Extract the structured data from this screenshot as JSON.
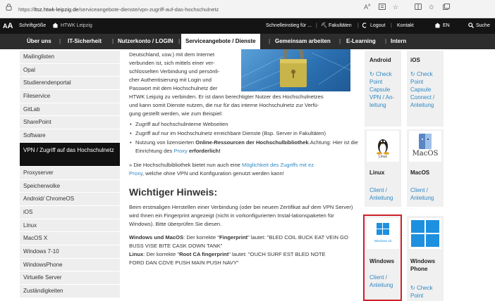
{
  "browser": {
    "url_prefix": "https://",
    "url_host": "ltsz.htwk-leipzig.de",
    "url_path": "/serviceangebote-dienste/vpn-zugriff-auf-das-hochschulnetz"
  },
  "topbar": {
    "font_size_label": "Schriftgröße",
    "home_label": "HTWK Leipzig",
    "quick_entry": "Schnelleinstieg für ...",
    "faculties": "Fakultäten",
    "logout": "Logout",
    "contact": "Kontakt",
    "language": "EN",
    "search": "Suche"
  },
  "mainnav": {
    "items": [
      "Über uns",
      "IT-Sicherheit",
      "Nutzerkonto / LOGIN",
      "Serviceangebote / Dienste",
      "Gemeinsam arbeiten",
      "E-Learning",
      "Intern"
    ]
  },
  "sidebar": {
    "items": [
      "Mailinglisten",
      "Opal",
      "Studierendenportal",
      "Fileservice",
      "GitLab",
      "SharePoint",
      "Software",
      "VPN / Zugriff auf das Hochschulnetz",
      "Proxyserver",
      "Speicherwolke",
      "Android/ ChromeOS",
      "iOS",
      "Linux",
      "MacOS X",
      "Windows 7-10",
      "WindowsPhone",
      "Virtuelle Server",
      "Zuständigkeiten"
    ]
  },
  "content": {
    "intro_lines": [
      "Deutschland, usw.) mit dem Internet",
      "verbunden ist, sich mittels einer ver-",
      "schlüsselten Verbindung und persönli-",
      "cher Authentisierung mit Login und",
      "Passwort mit dem Hochschulnetz der",
      "HTWK Leipzig zu verbinden. Er ist dann berechtigter Nutzer des Hochschulnetzes",
      "und kann somit Dienste nutzen, die nur für das interne Hochschulnetz zur Verfü-",
      "gung gestellt werden, wie zum Beispiel:"
    ],
    "bullet1": "Zugriff auf hochschulinterne Webseiten",
    "bullet2": "Zugriff auf nur im Hochschulnetz erreichbare Dienste (Bsp. Server in Fakultäten)",
    "bullet3_pre": "Nutzung von lizensierten ",
    "bullet3_bold": "Online-Ressourcen der Hochschulbibliothek",
    "bullet3_mid": ".Achtung: Hier ist die Einrichtung des ",
    "bullet3_link": "Proxy",
    "bullet3_end": " erforderlich!",
    "library_pre": "» Die Hochschulbibliothek bietet nun auch eine ",
    "library_link1": "Möglichkeit des Zugriffs mit ez",
    "library_link2": "Proxy",
    "library_post": ", welche ohne VPN und Konfiguration genutzt werden kann!",
    "heading": "Wichtiger Hinweis:",
    "notice": "Beim erstmaligen Herstellen einer Verbindung (oder bei neuem Zertifikat auf dem VPN Server) wird Ihnen ein Fingerprint angezeigt (nicht in vorkonfigurierten Instal-lationspaketen für Windows). Bitte überprüfen Sie diesen.",
    "winmac_label": "Windows und MacOS",
    "winmac_pre": ": Der korrekte \"",
    "winmac_bold": "Fingerprint",
    "winmac_post": "\" lautet: \"BLED COIL BUCK EAT VEIN GO BUSS VISE BITE CASK DOWN TANK\"",
    "linux_label": "Linux",
    "linux_pre": ": Der korrekte \"",
    "linux_bold": "Root CA fingerprint",
    "linux_post": "\" lautet: \"OUCH SURF EST BLED NOTE",
    "linux_line2": "FORD DAN COVE PUSH MAIN PUSH NAVY\""
  },
  "tiles": {
    "android": {
      "title": "Android",
      "links": [
        "Check",
        "Point",
        "Capsule",
        "VPN / An-",
        "leitung"
      ]
    },
    "ios": {
      "title": "iOS",
      "links": [
        "Check",
        "Point",
        "Capsule",
        "Connect /",
        "Anleitung"
      ]
    },
    "linux": {
      "title": "Linux",
      "icon_caption": "Linux",
      "links": [
        "Client /",
        "Anleitung"
      ]
    },
    "macos": {
      "title": "MacOS",
      "icon_caption": "MacOS",
      "links": [
        "Client /",
        "Anleitung"
      ]
    },
    "windows": {
      "title": "Windows",
      "icon_caption": "Windows 10",
      "links": [
        "Client /",
        "Anleitung"
      ]
    },
    "windowsphone": {
      "title": "Windows Phone",
      "links": [
        "Check",
        "Point"
      ]
    }
  },
  "colors": {
    "accent": "#2f88c5",
    "highlight": "#d11f2a",
    "nav_dark": "#2d2d2d"
  }
}
